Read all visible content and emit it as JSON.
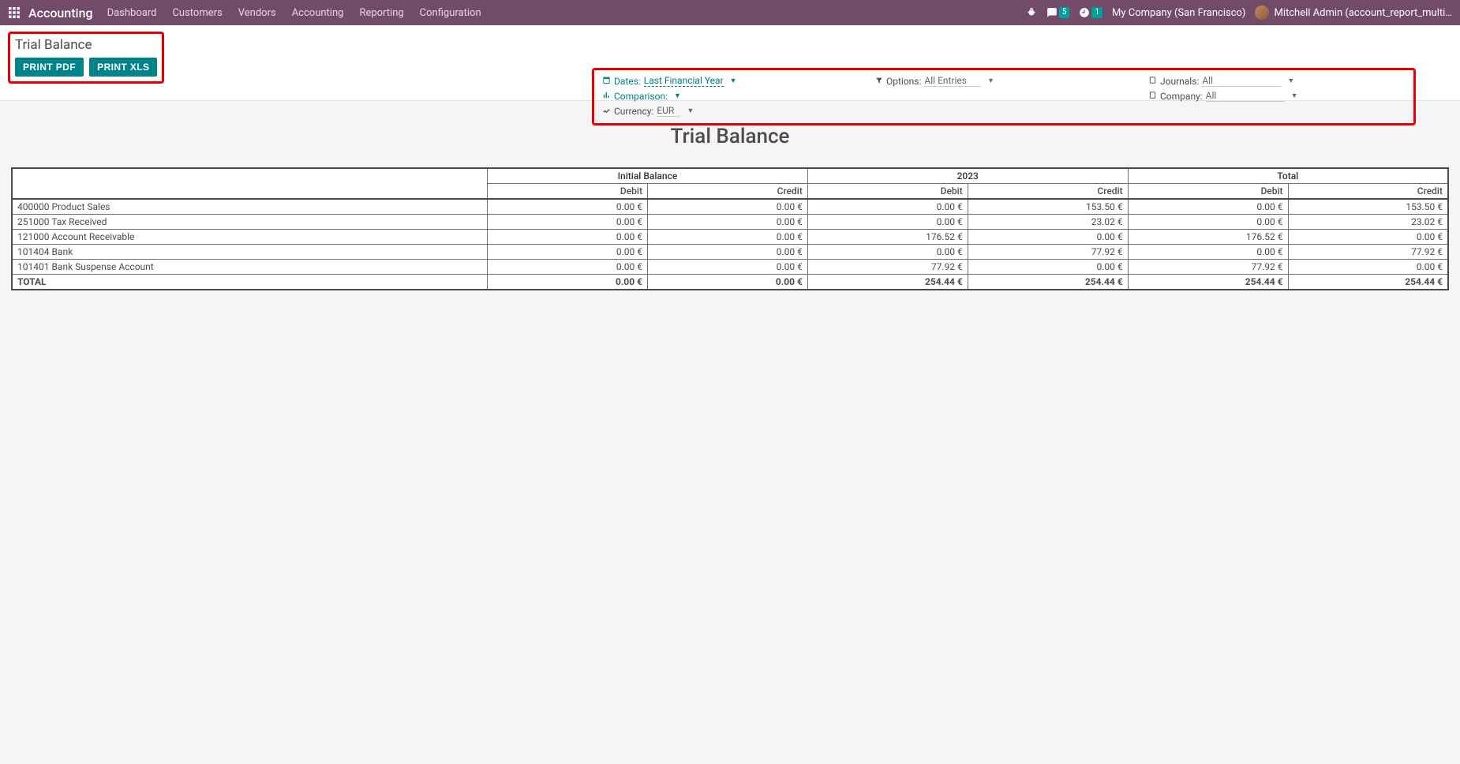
{
  "navbar": {
    "brand": "Accounting",
    "links": [
      "Dashboard",
      "Customers",
      "Vendors",
      "Accounting",
      "Reporting",
      "Configuration"
    ],
    "msg_badge": "5",
    "activity_badge": "1",
    "company": "My Company (San Francisco)",
    "user": "Mitchell Admin (account_report_multi…"
  },
  "panel": {
    "title": "Trial Balance",
    "btn_pdf": "PRINT PDF",
    "btn_xls": "PRINT XLS"
  },
  "filters": {
    "dates_label": "Dates:",
    "dates_value": "Last Financial Year",
    "comparison_label": "Comparison:",
    "currency_label": "Currency:",
    "currency_value": "EUR",
    "options_label": "Options:",
    "options_value": "All Entries",
    "journals_label": "Journals:",
    "journals_value": "All",
    "company_label": "Company:",
    "company_value": "All"
  },
  "report": {
    "title": "Trial Balance",
    "groups": [
      "Initial Balance",
      "2023",
      "Total"
    ],
    "sub": [
      "Debit",
      "Credit",
      "Debit",
      "Credit",
      "Debit",
      "Credit"
    ],
    "rows": [
      {
        "name": "400000 Product Sales",
        "v": [
          "0.00 €",
          "0.00 €",
          "0.00 €",
          "153.50 €",
          "0.00 €",
          "153.50 €"
        ]
      },
      {
        "name": "251000 Tax Received",
        "v": [
          "0.00 €",
          "0.00 €",
          "0.00 €",
          "23.02 €",
          "0.00 €",
          "23.02 €"
        ]
      },
      {
        "name": "121000 Account Receivable",
        "v": [
          "0.00 €",
          "0.00 €",
          "176.52 €",
          "0.00 €",
          "176.52 €",
          "0.00 €"
        ]
      },
      {
        "name": "101404 Bank",
        "v": [
          "0.00 €",
          "0.00 €",
          "0.00 €",
          "77.92 €",
          "0.00 €",
          "77.92 €"
        ]
      },
      {
        "name": "101401 Bank Suspense Account",
        "v": [
          "0.00 €",
          "0.00 €",
          "77.92 €",
          "0.00 €",
          "77.92 €",
          "0.00 €"
        ]
      }
    ],
    "total": {
      "name": "TOTAL",
      "v": [
        "0.00 €",
        "0.00 €",
        "254.44 €",
        "254.44 €",
        "254.44 €",
        "254.44 €"
      ]
    }
  }
}
